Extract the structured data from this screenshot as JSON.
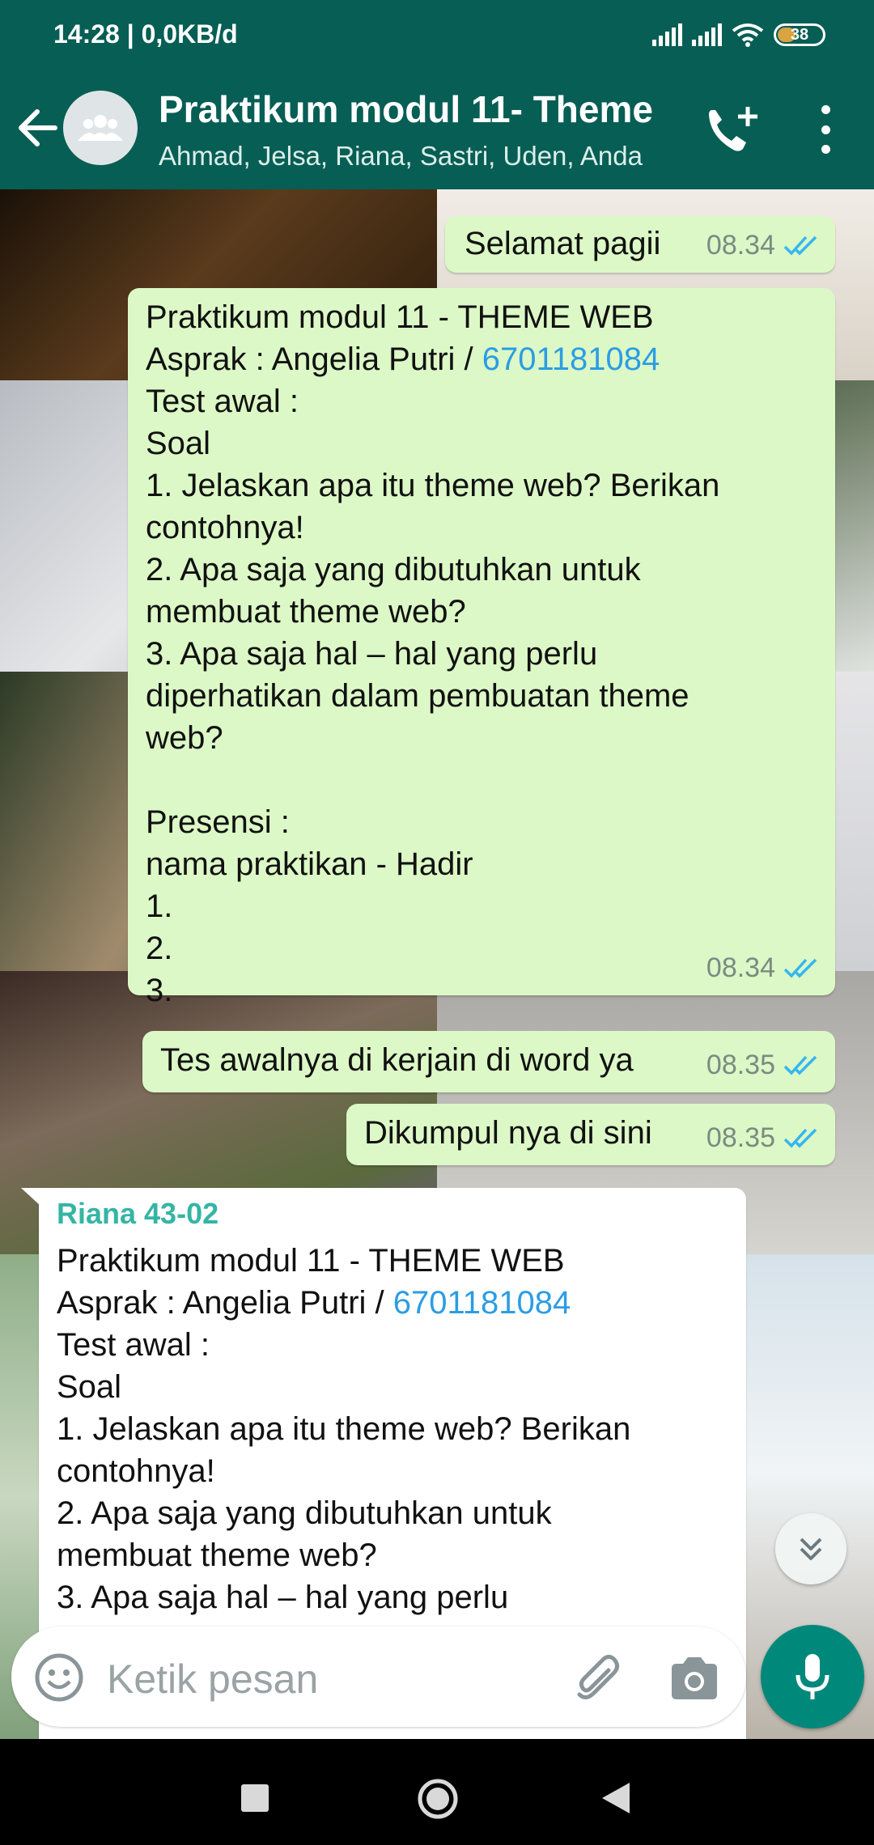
{
  "status_bar": {
    "time_and_data": "14:28 | 0,0KB/d",
    "battery": "38"
  },
  "header": {
    "title": "Praktikum modul 11- Theme",
    "subtitle": "Ahmad, Jelsa, Riana, Sastri, Uden, Anda"
  },
  "messages": [
    {
      "direction": "out",
      "text": "Selamat pagii",
      "time": "08.34"
    },
    {
      "direction": "out",
      "line1": "Praktikum modul 11 -  THEME WEB",
      "line2_prefix": "Asprak : Angelia Putri / ",
      "phone": "6701181084",
      "rest": "Test awal :\nSoal\n1. Jelaskan apa itu theme web? Berikan\ncontohnya!\n2. Apa saja yang dibutuhkan untuk\nmembuat theme web?\n3. Apa saja hal – hal yang perlu\ndiperhatikan dalam pembuatan theme\nweb?\n\nPresensi :\nnama praktikan - Hadir\n1.\n2.\n3.",
      "time": "08.34"
    },
    {
      "direction": "out",
      "text": "Tes awalnya di kerjain di word ya",
      "time": "08.35"
    },
    {
      "direction": "out",
      "text": "Dikumpul nya di sini",
      "time": "08.35"
    },
    {
      "direction": "in",
      "sender": "Riana 43-02",
      "line1": "Praktikum modul 11 -  THEME WEB",
      "line2_prefix": "Asprak : Angelia Putri / ",
      "phone": "6701181084",
      "rest": "Test awal :\nSoal\n1. Jelaskan apa itu theme web? Berikan\ncontohnya!\n2. Apa saja yang dibutuhkan untuk\nmembuat theme web?\n3. Apa saja hal – hal yang perlu"
    }
  ],
  "input": {
    "placeholder": "Ketik pesan"
  },
  "colors": {
    "header": "#075e54",
    "outgoing_bubble": "#dcf8c6",
    "incoming_bubble": "#ffffff",
    "accent": "#00897b",
    "read_ticks": "#34b7f1"
  },
  "icons": [
    "back-arrow-icon",
    "group-avatar-icon",
    "add-call-icon",
    "more-vert-icon",
    "emoji-icon",
    "attach-icon",
    "camera-icon",
    "mic-icon",
    "double-check-icon",
    "chevron-double-down-icon"
  ]
}
